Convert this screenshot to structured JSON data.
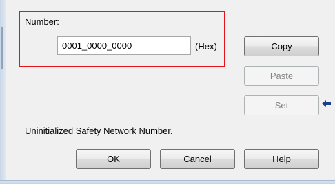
{
  "number_group": {
    "label": "Number:",
    "value": "0001_0000_0000",
    "unit": "(Hex)"
  },
  "buttons": {
    "copy": "Copy",
    "paste": "Paste",
    "set": "Set",
    "ok": "OK",
    "cancel": "Cancel",
    "help": "Help"
  },
  "status": "Uninitialized Safety Network Number.",
  "icons": {
    "set_indicator": "left-arrow-icon"
  },
  "colors": {
    "highlight_border": "#e2141a",
    "arrow": "#1c3f8c",
    "disabled_text": "#838383"
  }
}
